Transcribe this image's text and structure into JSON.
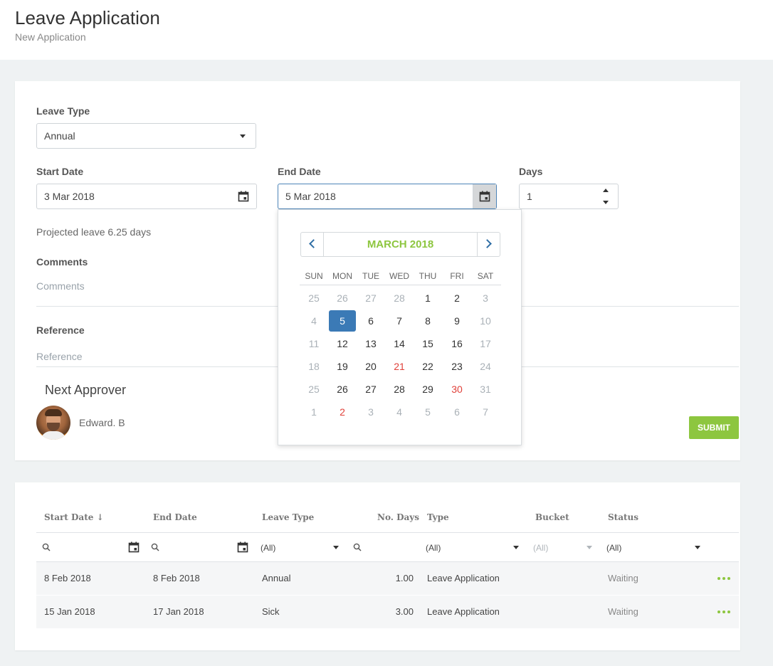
{
  "header": {
    "title": "Leave Application",
    "subtitle": "New Application"
  },
  "form": {
    "leave_type": {
      "label": "Leave Type",
      "value": "Annual"
    },
    "start_date": {
      "label": "Start Date",
      "value": "3 Mar 2018"
    },
    "end_date": {
      "label": "End Date",
      "value": "5 Mar 2018"
    },
    "days": {
      "label": "Days",
      "value": "1"
    },
    "projected_leave": "Projected leave 6.25 days",
    "comments": {
      "label": "Comments",
      "placeholder": "Comments"
    },
    "reference": {
      "label": "Reference",
      "placeholder": "Reference"
    },
    "next_approver": {
      "label": "Next Approver",
      "name": "Edward. B"
    },
    "submit_label": "SUBMIT"
  },
  "calendar": {
    "month_label": "MARCH 2018",
    "weekdays": [
      "SUN",
      "MON",
      "TUE",
      "WED",
      "THU",
      "FRI",
      "SAT"
    ],
    "weeks": [
      [
        {
          "d": "25",
          "muted": true
        },
        {
          "d": "26",
          "muted": true
        },
        {
          "d": "27",
          "muted": true
        },
        {
          "d": "28",
          "muted": true
        },
        {
          "d": "1"
        },
        {
          "d": "2"
        },
        {
          "d": "3",
          "muted": true
        }
      ],
      [
        {
          "d": "4",
          "muted": true
        },
        {
          "d": "5",
          "selected": true
        },
        {
          "d": "6"
        },
        {
          "d": "7"
        },
        {
          "d": "8"
        },
        {
          "d": "9"
        },
        {
          "d": "10",
          "muted": true
        }
      ],
      [
        {
          "d": "11",
          "muted": true
        },
        {
          "d": "12"
        },
        {
          "d": "13"
        },
        {
          "d": "14"
        },
        {
          "d": "15"
        },
        {
          "d": "16"
        },
        {
          "d": "17",
          "muted": true
        }
      ],
      [
        {
          "d": "18",
          "muted": true
        },
        {
          "d": "19"
        },
        {
          "d": "20"
        },
        {
          "d": "21",
          "holiday": true
        },
        {
          "d": "22"
        },
        {
          "d": "23"
        },
        {
          "d": "24",
          "muted": true
        }
      ],
      [
        {
          "d": "25",
          "muted": true
        },
        {
          "d": "26"
        },
        {
          "d": "27"
        },
        {
          "d": "28"
        },
        {
          "d": "29"
        },
        {
          "d": "30",
          "holiday": true
        },
        {
          "d": "31",
          "muted": true
        }
      ],
      [
        {
          "d": "1",
          "muted": true
        },
        {
          "d": "2",
          "holiday": true
        },
        {
          "d": "3",
          "muted": true
        },
        {
          "d": "4",
          "muted": true
        },
        {
          "d": "5",
          "muted": true
        },
        {
          "d": "6",
          "muted": true
        },
        {
          "d": "7",
          "muted": true
        }
      ]
    ]
  },
  "grid": {
    "columns": [
      "Start Date ↓",
      "End Date",
      "Leave Type",
      "No. Days",
      "Type",
      "Bucket",
      "Status"
    ],
    "filters": {
      "leave_type": "(All)",
      "type": "(All)",
      "bucket": "(All)",
      "status": "(All)"
    },
    "rows": [
      {
        "start": "8 Feb 2018",
        "end": "8 Feb 2018",
        "leave_type": "Annual",
        "days": "1.00",
        "type": "Leave Application",
        "bucket": "",
        "status": "Waiting"
      },
      {
        "start": "15 Jan 2018",
        "end": "17 Jan 2018",
        "leave_type": "Sick",
        "days": "3.00",
        "type": "Leave Application",
        "bucket": "",
        "status": "Waiting"
      }
    ]
  },
  "colors": {
    "accent_green": "#8dc63f",
    "primary_blue": "#3b7ab6",
    "holiday_red": "#e0413a"
  }
}
